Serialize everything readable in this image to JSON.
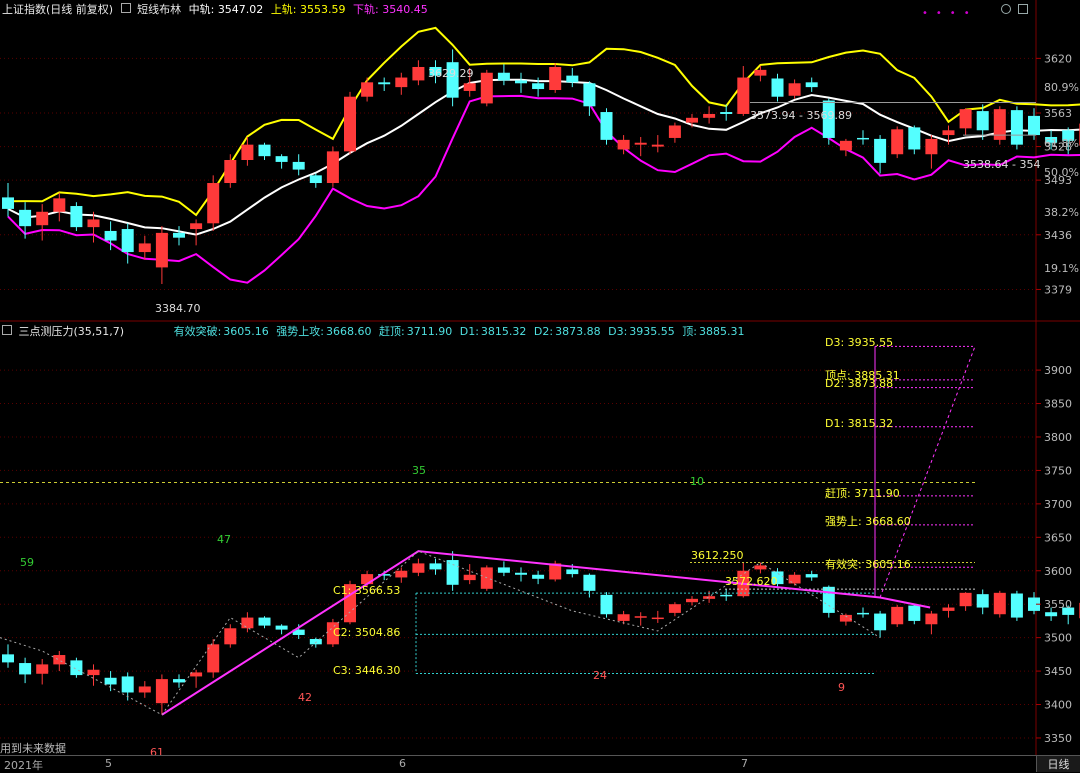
{
  "top_header": {
    "title": "上证指数(日线 前复权)",
    "indicator": "短线布林",
    "mid_label": "中轨:",
    "mid_value": "3547.02",
    "upper_label": "上轨:",
    "upper_value": "3553.59",
    "lower_label": "下轨:",
    "lower_value": "3540.45"
  },
  "sub_header": {
    "indicator": "三点测压力(35,51,7)",
    "items": [
      {
        "label": "有效突破:",
        "value": "3605.16"
      },
      {
        "label": "强势上攻:",
        "value": "3668.60"
      },
      {
        "label": "赶顶:",
        "value": "3711.90"
      },
      {
        "label": "D1:",
        "value": "3815.32"
      },
      {
        "label": "D2:",
        "value": "3873.88"
      },
      {
        "label": "D3:",
        "value": "3935.55"
      },
      {
        "label": "顶:",
        "value": "3885.31"
      }
    ]
  },
  "colors": {
    "up": "#ff3a3a",
    "down": "#54ffff",
    "upper_band": "#ffff00",
    "mid_band": "#ffffff",
    "lower_band": "#ff00ff",
    "trend": "#ff33ff",
    "grid": "#5a0000"
  },
  "top_axis": {
    "ticks": [
      "3620",
      "3563",
      "3528",
      "3493",
      "3436",
      "3379"
    ],
    "fibs": [
      "80.9%",
      "61.8%",
      "50.0%",
      "38.2%",
      "19.1%"
    ]
  },
  "sub_axis": {
    "ticks": [
      "3900",
      "3850",
      "3800",
      "3750",
      "3700",
      "3650",
      "3600",
      "3550",
      "3500",
      "3450",
      "3400",
      "3350"
    ]
  },
  "top_annotations": {
    "high": "3629.29",
    "low": "3384.70",
    "range1": "3573.94 - 3569.89",
    "range2": "3538.64 - 354"
  },
  "sub_annotations": {
    "c1": "C1: 3566.53",
    "c2": "C2: 3504.86",
    "c3": "C3: 3446.30",
    "p1": "3612.250",
    "p2": "3572.620",
    "yxtp": "有效突: 3605.16",
    "qssg": "强势上: 3668.60",
    "gd": "赶顶: 3711.90",
    "d1": "D1: 3815.32",
    "d2": "D2: 3873.88",
    "dd": "顶点: 3885.31",
    "d3": "D3: 3935.55",
    "n35": "35",
    "n10": "10",
    "n59": "59",
    "n47": "47",
    "n42": "42",
    "n61": "61",
    "n24": "24",
    "n9": "9"
  },
  "bottom_note": "用到未来数据",
  "date_axis": [
    "2021年",
    "5",
    "6",
    "7"
  ],
  "period_button": "日线",
  "chart_data": {
    "type": "candlestick",
    "title": "上证指数(日线 前复权)",
    "candles": [
      [
        3475,
        3463,
        3490,
        3455
      ],
      [
        3462,
        3445,
        3470,
        3432
      ],
      [
        3446,
        3460,
        3468,
        3430
      ],
      [
        3460,
        3474,
        3480,
        3450
      ],
      [
        3466,
        3444,
        3470,
        3440
      ],
      [
        3444,
        3452,
        3460,
        3428
      ],
      [
        3440,
        3430,
        3450,
        3420
      ],
      [
        3442,
        3418,
        3448,
        3406
      ],
      [
        3418,
        3427,
        3435,
        3410
      ],
      [
        3402,
        3438,
        3445,
        3384.7
      ],
      [
        3438,
        3433,
        3445,
        3425
      ],
      [
        3442,
        3448,
        3452,
        3425
      ],
      [
        3448,
        3490,
        3498,
        3440
      ],
      [
        3490,
        3514,
        3520,
        3485
      ],
      [
        3514,
        3530,
        3538,
        3508
      ],
      [
        3530,
        3518,
        3532,
        3514
      ],
      [
        3518,
        3512,
        3520,
        3505
      ],
      [
        3512,
        3504,
        3520,
        3498
      ],
      [
        3498,
        3490,
        3500,
        3485
      ],
      [
        3490,
        3523,
        3528,
        3486
      ],
      [
        3523,
        3580,
        3585,
        3520
      ],
      [
        3580,
        3595,
        3600,
        3575
      ],
      [
        3595,
        3593,
        3600,
        3586
      ],
      [
        3590,
        3600,
        3605,
        3582
      ],
      [
        3597,
        3611,
        3618,
        3592
      ],
      [
        3611,
        3602,
        3618,
        3594
      ],
      [
        3616,
        3579,
        3629.29,
        3570
      ],
      [
        3586,
        3594,
        3610,
        3580
      ],
      [
        3573,
        3605,
        3608,
        3570
      ],
      [
        3605,
        3597,
        3614,
        3592
      ],
      [
        3597,
        3594,
        3605,
        3584
      ],
      [
        3594,
        3588,
        3600,
        3580
      ],
      [
        3587,
        3611,
        3615,
        3584
      ],
      [
        3602,
        3595,
        3610,
        3590
      ],
      [
        3594,
        3570,
        3596,
        3560
      ],
      [
        3564,
        3535,
        3568,
        3530
      ],
      [
        3525,
        3535,
        3540,
        3520
      ],
      [
        3530,
        3532,
        3538,
        3518
      ],
      [
        3528,
        3530,
        3540,
        3522
      ],
      [
        3537,
        3550,
        3553,
        3532
      ],
      [
        3553,
        3558,
        3562,
        3548
      ],
      [
        3558,
        3562,
        3570,
        3552
      ],
      [
        3564,
        3562,
        3572,
        3555
      ],
      [
        3562,
        3600,
        3612,
        3560
      ],
      [
        3602,
        3608,
        3612.25,
        3596
      ],
      [
        3599,
        3580,
        3604,
        3575
      ],
      [
        3581,
        3594,
        3598,
        3578
      ],
      [
        3595,
        3590,
        3600,
        3585
      ],
      [
        3576,
        3537,
        3578,
        3530
      ],
      [
        3524,
        3534,
        3536,
        3518
      ],
      [
        3537,
        3536,
        3545,
        3530
      ],
      [
        3536,
        3511,
        3540,
        3500
      ],
      [
        3520,
        3546,
        3549,
        3516
      ],
      [
        3548,
        3525,
        3550,
        3520
      ],
      [
        3520,
        3536,
        3540,
        3505
      ],
      [
        3540,
        3545,
        3550,
        3530
      ],
      [
        3547,
        3567,
        3568,
        3540
      ],
      [
        3565,
        3545,
        3572,
        3535
      ],
      [
        3535,
        3567,
        3570,
        3530
      ],
      [
        3566,
        3530,
        3570,
        3525
      ],
      [
        3560,
        3540,
        3568,
        3535
      ],
      [
        3538,
        3532,
        3545,
        3525
      ],
      [
        3545,
        3534,
        3548,
        3520
      ],
      [
        3529,
        3552,
        3560,
        3525
      ]
    ],
    "bollinger": {
      "mid_last": 3547.02,
      "upper_last": 3553.59,
      "lower_last": 3540.45
    },
    "levels": {
      "有效突破": 3605.16,
      "强势上攻": 3668.6,
      "赶顶": 3711.9,
      "D1": 3815.32,
      "D2": 3873.88,
      "D3": 3935.55,
      "顶": 3885.31,
      "C1": 3566.53,
      "C2": 3504.86,
      "C3": 3446.3
    },
    "top_ylim": [
      3368,
      3660
    ],
    "sub_ylim": [
      3335,
      3945
    ]
  }
}
